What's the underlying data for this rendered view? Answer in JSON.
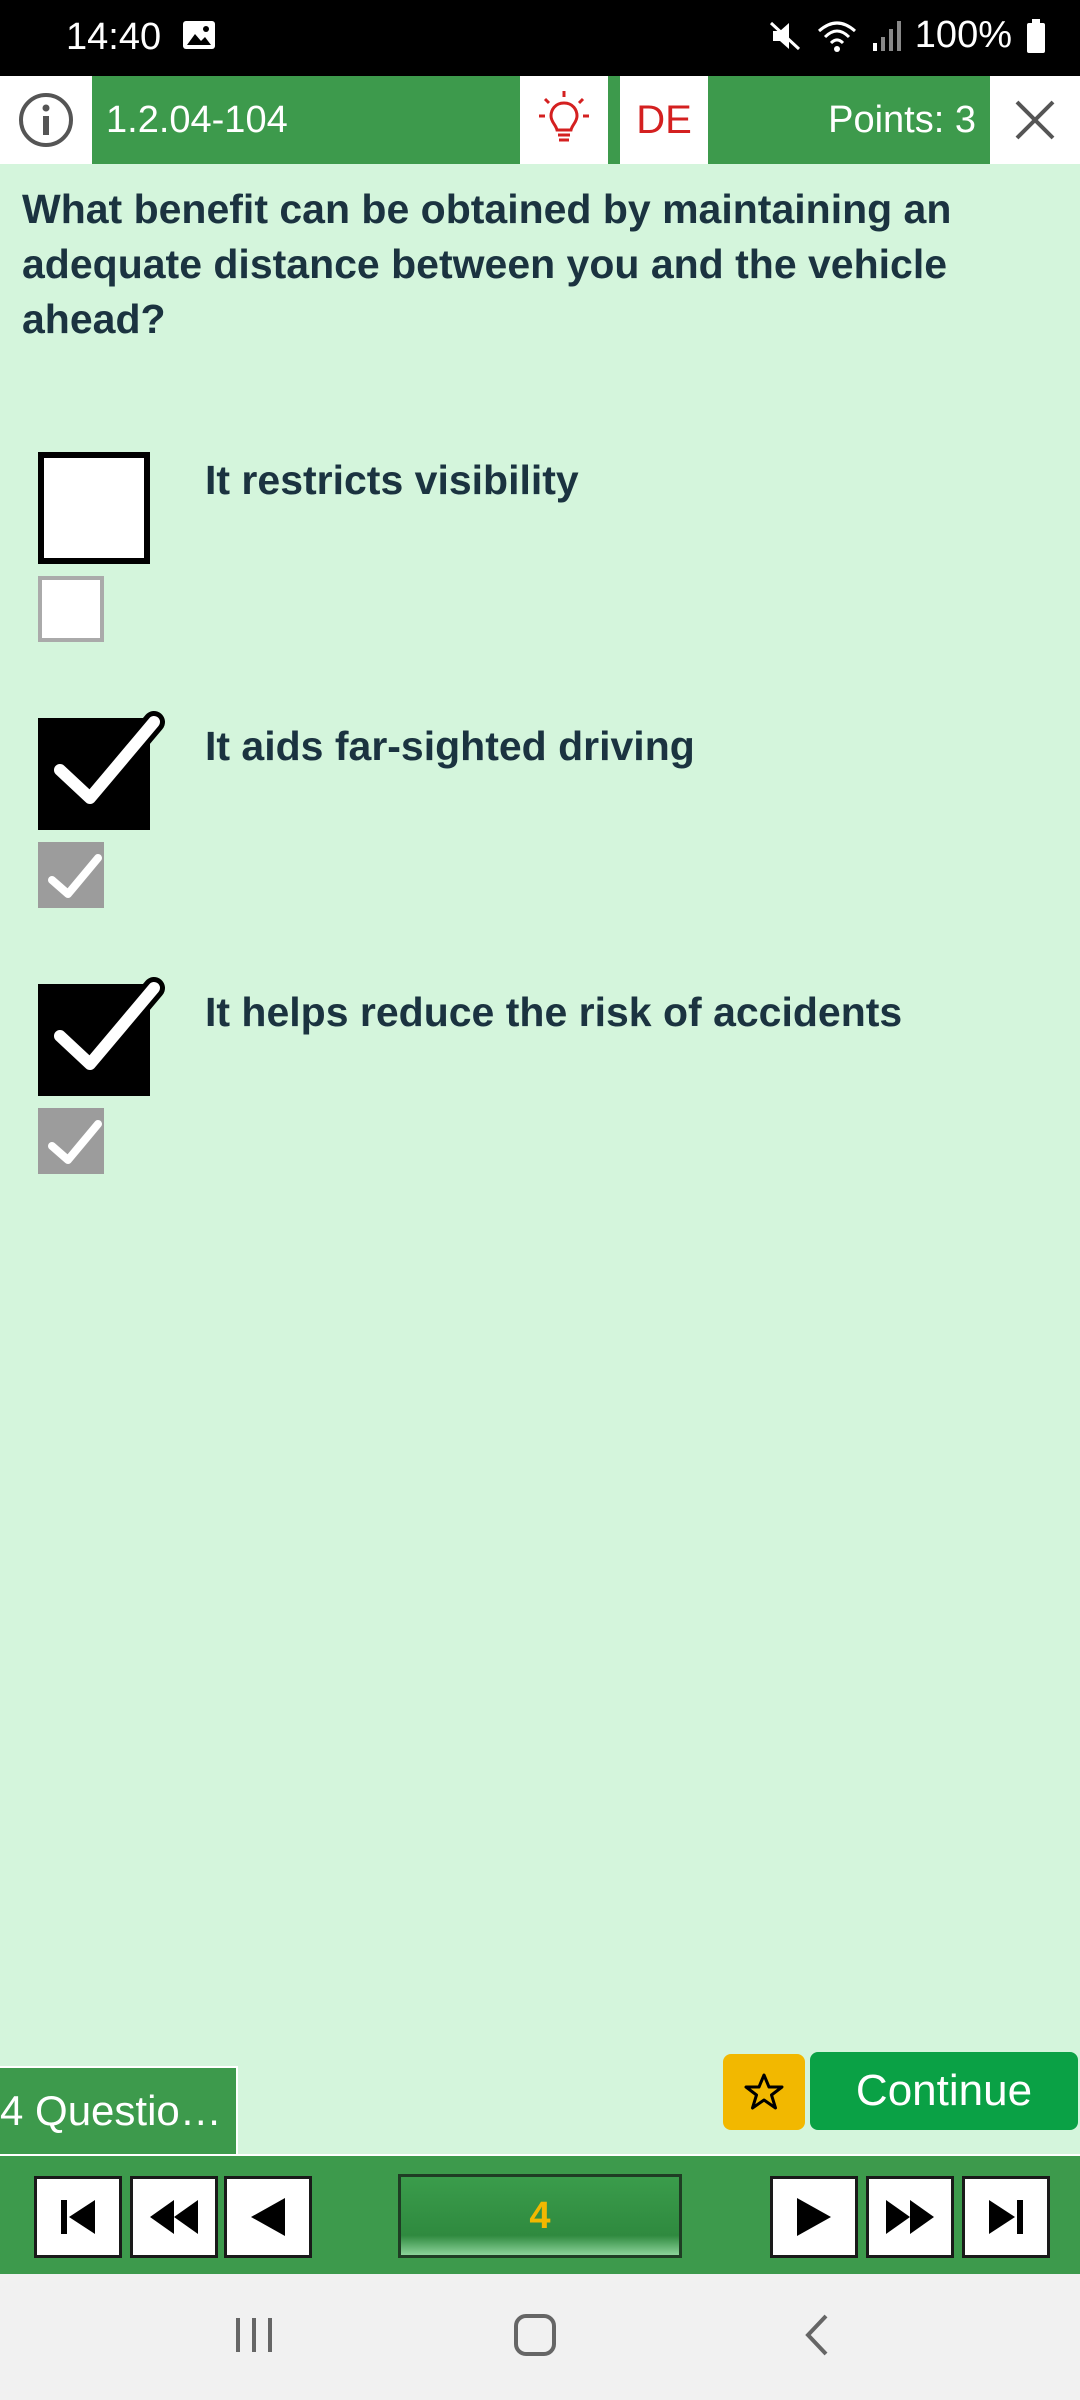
{
  "status_bar": {
    "time": "14:40",
    "battery": "100%"
  },
  "header": {
    "question_id": "1.2.04-104",
    "language": "DE",
    "points": "Points: 3"
  },
  "question": {
    "text": "What benefit can be obtained by maintaining an adequate distance between you and the vehicle ahead?"
  },
  "answers": [
    {
      "text": "It restricts visibility",
      "checked": false,
      "solution_checked": false
    },
    {
      "text": "It aids far-sighted driving",
      "checked": true,
      "solution_checked": true
    },
    {
      "text": "It helps reduce the risk of accidents",
      "checked": true,
      "solution_checked": true
    }
  ],
  "footer": {
    "questions_tab": "4 Questio…",
    "continue_label": "Continue"
  },
  "navigation": {
    "current_page": "4"
  },
  "colors": {
    "header_green": "#3d9a4c",
    "background": "#d4f5dc",
    "continue_green": "#0aa145",
    "star_yellow": "#f2b800",
    "lang_red": "#d42020"
  }
}
